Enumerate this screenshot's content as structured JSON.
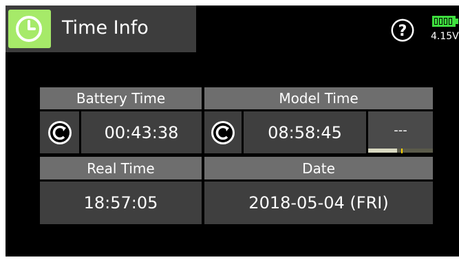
{
  "header": {
    "title": "Time Info",
    "app_icon": "clock-icon",
    "help_icon": "question-icon",
    "battery_icon": "battery-icon",
    "voltage": "4.15V"
  },
  "battery_time": {
    "label": "Battery Time",
    "value": "00:43:38",
    "reset_icon": "reset-icon"
  },
  "model_time": {
    "label": "Model Time",
    "value": "08:58:45",
    "timer_value": "---",
    "reset_icon": "reset-icon",
    "progress": 0.45
  },
  "real_time": {
    "label": "Real Time",
    "value": "18:57:05"
  },
  "date": {
    "label": "Date",
    "value": "2018-05-04 (FRI)"
  },
  "colors": {
    "accent": "#a6ea69",
    "battery": "#3fe03f",
    "header_cell": "#6e6e6e",
    "value_cell": "#3f3f3f",
    "background": "#000000"
  }
}
